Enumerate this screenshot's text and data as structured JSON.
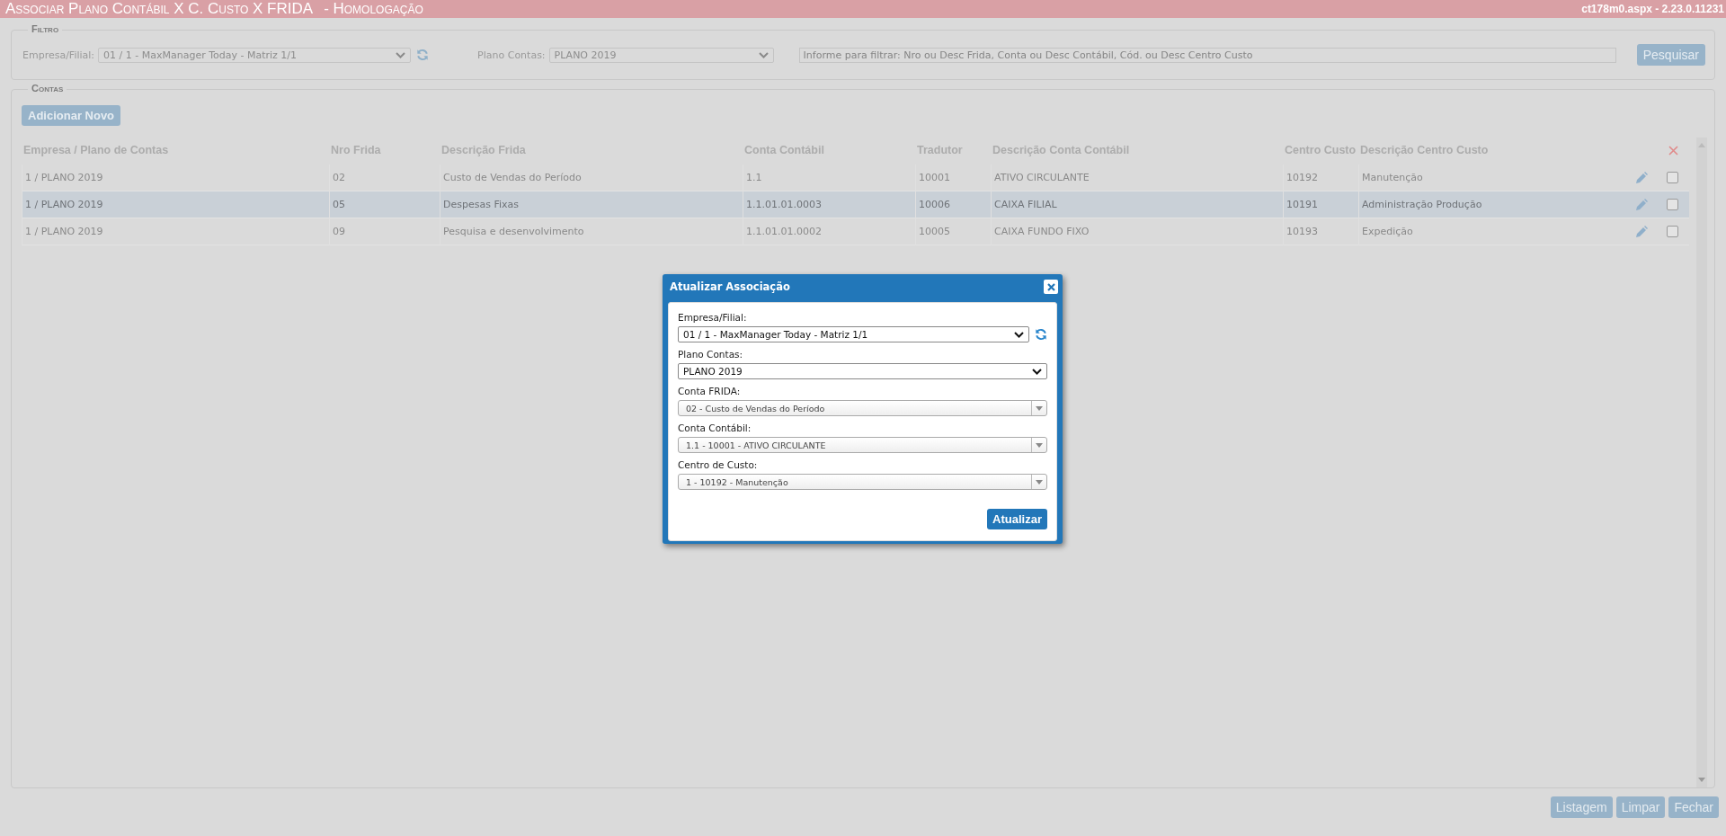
{
  "title_bar": {
    "title": "Associar Plano Contábil X C. Custo X FRIDA",
    "subtitle": "- Homologação",
    "version": "ct178m0.aspx - 2.23.0.11231"
  },
  "filter": {
    "legend": "Filtro",
    "empresa_label": "Empresa/Filial:",
    "empresa_value": "01 / 1 - MaxManager Today - Matriz 1/1",
    "plano_label": "Plano Contas:",
    "plano_value": "PLANO 2019",
    "search_placeholder": "Informe para filtrar: Nro ou Desc Frida, Conta ou Desc Contábil, Cód. ou Desc Centro Custo",
    "search_button": "Pesquisar"
  },
  "contas": {
    "legend": "Contas",
    "add_button": "Adicionar Novo",
    "columns": [
      "Empresa / Plano de Contas",
      "Nro Frida",
      "Descrição Frida",
      "Conta Contábil",
      "Tradutor",
      "Descrição Conta Contábil",
      "Centro Custo",
      "Descrição Centro Custo"
    ],
    "rows": [
      {
        "cells": [
          "1 / PLANO 2019",
          "02",
          "Custo de Vendas do Período",
          "1.1",
          "10001",
          "ATIVO CIRCULANTE",
          "10192",
          "Manutenção"
        ],
        "selected": false,
        "checked": false
      },
      {
        "cells": [
          "1 / PLANO 2019",
          "05",
          "Despesas Fixas",
          "1.1.01.01.0003",
          "10006",
          "CAIXA FILIAL",
          "10191",
          "Administração Produção"
        ],
        "selected": true,
        "checked": false
      },
      {
        "cells": [
          "1 / PLANO 2019",
          "09",
          "Pesquisa e desenvolvimento",
          "1.1.01.01.0002",
          "10005",
          "CAIXA FUNDO FIXO",
          "10193",
          "Expedição"
        ],
        "selected": false,
        "checked": false
      }
    ]
  },
  "footer_buttons": [
    "Listagem",
    "Limpar",
    "Fechar"
  ],
  "dialog": {
    "title": "Atualizar Associação",
    "fields": [
      {
        "label": "Empresa/Filial:",
        "value": "01 / 1 - MaxManager Today - Matriz 1/1",
        "kind": "native",
        "refresh": true
      },
      {
        "label": "Plano Contas:",
        "value": "PLANO 2019",
        "kind": "native",
        "refresh": false
      },
      {
        "label": "Conta FRIDA:",
        "value": "02 - Custo de Vendas do Período",
        "kind": "combo",
        "refresh": false
      },
      {
        "label": "Conta Contábil:",
        "value": "1.1 - 10001 - ATIVO CIRCULANTE",
        "kind": "combo",
        "refresh": false
      },
      {
        "label": "Centro de Custo:",
        "value": "1 - 10192 - Manutenção",
        "kind": "combo",
        "refresh": false
      }
    ],
    "submit": "Atualizar"
  }
}
